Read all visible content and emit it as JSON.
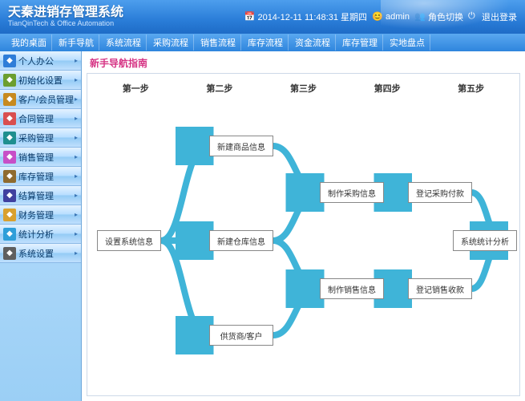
{
  "header": {
    "title": "天秦进销存管理系统",
    "subtitle": "TianQinTech & Office Automation",
    "datetime": "2014-12-11 11:48:31 星期四",
    "user": "admin",
    "role_switch": "角色切换",
    "logout": "退出登录"
  },
  "tabs": [
    "我的桌面",
    "新手导航",
    "系统流程",
    "采购流程",
    "销售流程",
    "库存流程",
    "资金流程",
    "库存管理",
    "实地盘点"
  ],
  "sidebar": [
    {
      "label": "个人办公",
      "color": "#2e7dd8"
    },
    {
      "label": "初始化设置",
      "color": "#6b9e2f"
    },
    {
      "label": "客户/会员管理",
      "color": "#c78a1f"
    },
    {
      "label": "合同管理",
      "color": "#d94f4f"
    },
    {
      "label": "采购管理",
      "color": "#1f8f8f"
    },
    {
      "label": "销售管理",
      "color": "#c74fc7"
    },
    {
      "label": "库存管理",
      "color": "#8f6b2f"
    },
    {
      "label": "结算管理",
      "color": "#3f3f9f"
    },
    {
      "label": "财务管理",
      "color": "#d9a02e"
    },
    {
      "label": "统计分析",
      "color": "#2e9ed9"
    },
    {
      "label": "系统设置",
      "color": "#5f5f5f"
    }
  ],
  "panel": {
    "title": "新手导航指南",
    "step_labels": [
      "第一步",
      "第二步",
      "第三步",
      "第四步",
      "第五步"
    ],
    "nodes": {
      "n1": "设置系统信息",
      "n2a": "新建商品信息",
      "n2b": "新建仓库信息",
      "n2c": "供货商/客户",
      "n3a": "制作采购信息",
      "n3b": "制作销售信息",
      "n4a": "登记采购付款",
      "n4b": "登记销售收款",
      "n5": "系统统计分析"
    }
  }
}
